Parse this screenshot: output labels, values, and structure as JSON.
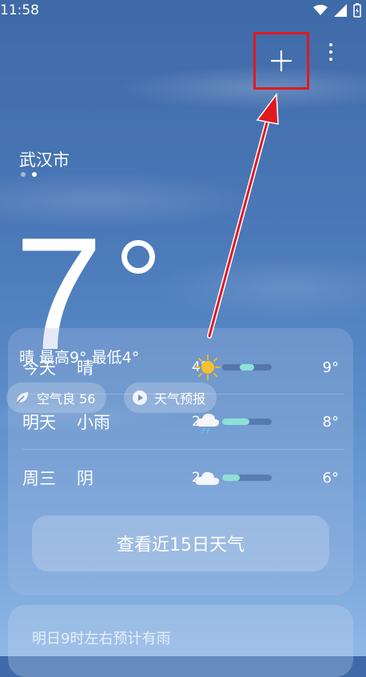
{
  "status": {
    "time": "11:58"
  },
  "header": {
    "city": "武汉市"
  },
  "current": {
    "temp": "7",
    "summary": "晴 最高9° 最低4°"
  },
  "chips": {
    "aqi": "空气良 56",
    "video": "天气预报"
  },
  "forecast": [
    {
      "day": "今天",
      "cond": "晴",
      "low": "4°",
      "high": "9°",
      "bar": [
        0.35,
        0.65
      ],
      "icon": "sun-icon"
    },
    {
      "day": "明天",
      "cond": "小雨",
      "low": "2",
      "high": "8°",
      "bar": [
        0.0,
        0.55
      ],
      "icon": "rain-cloud-icon"
    },
    {
      "day": "周三",
      "cond": "阴",
      "low": "2",
      "high": "6°",
      "bar": [
        0.0,
        0.35
      ],
      "icon": "cloud-icon"
    }
  ],
  "buttons": {
    "fifteen_day": "查看近15日天气"
  },
  "notice": {
    "text": "明日9时左右预计有雨"
  },
  "colors": {
    "highlight": "#e0191f",
    "bar_fill": "#8fe0d8"
  }
}
